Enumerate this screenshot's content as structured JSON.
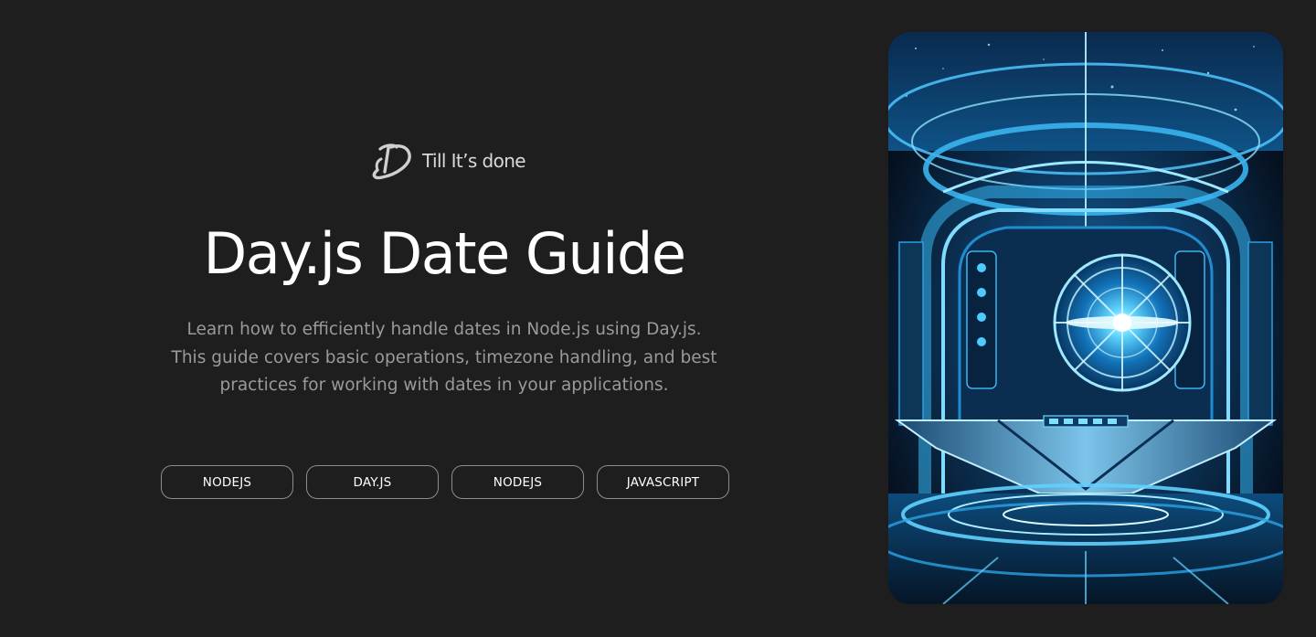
{
  "brand": {
    "name": "Till It’s done",
    "logo_icon": "td-monogram-icon"
  },
  "hero": {
    "title": "Day.js Date Guide",
    "description": "Learn how to efficiently handle dates in Node.js using Day.js. This guide covers basic operations, timezone handling, and best practices for working with dates in your applications."
  },
  "tags": [
    {
      "label": "NODEJS"
    },
    {
      "label": "DAY.JS"
    },
    {
      "label": "NODEJS"
    },
    {
      "label": "JAVASCRIPT"
    }
  ],
  "colors": {
    "background": "#1e1e1e",
    "title": "#ffffff",
    "description": "#9a9a9a",
    "tag_border": "#8d8d8d",
    "accent": "#2fd0ff"
  }
}
